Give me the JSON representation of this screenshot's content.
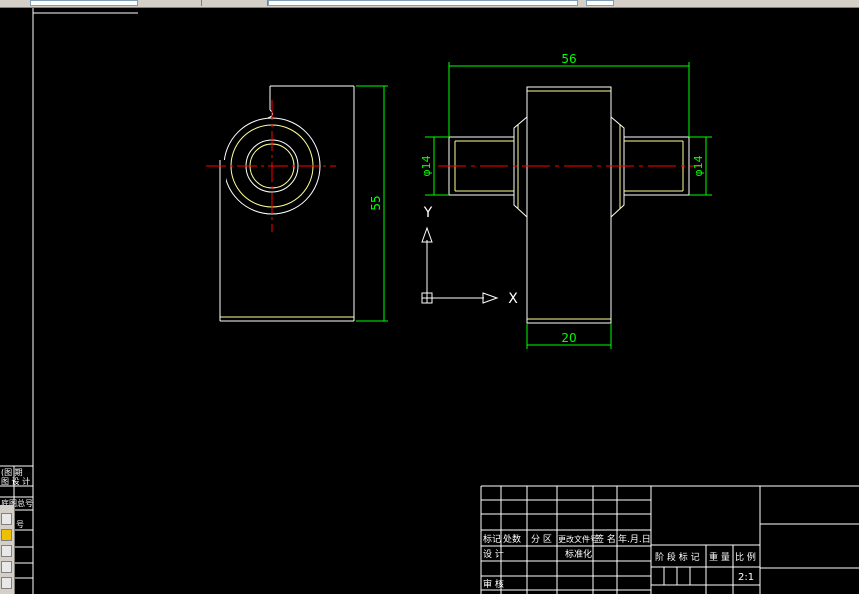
{
  "toolbar": {
    "layer_field": "",
    "linetype_field": ""
  },
  "drawing": {
    "dim_overall_width": "56",
    "dim_height": "55",
    "dim_diameter_left": "φ14",
    "dim_diameter_right": "φ14",
    "dim_bottom_width": "20",
    "ucs_x_label": "X",
    "ucs_y_label": "Y",
    "colors": {
      "background": "#000000",
      "geometry": "#ffffff",
      "dimension": "#00ff00",
      "centerline": "#ff0000",
      "hidden": "#ffff00"
    }
  },
  "title_block": {
    "rev_mark": "标记",
    "rev_count": "处数",
    "rev_zone": "分 区",
    "rev_doc": "更改文件号",
    "rev_sign": "签 名",
    "rev_date": "年.月.日",
    "design": "设 计",
    "standardize": "标准化",
    "review": "审 核",
    "stage_mark": "阶 段 标 记",
    "weight": "重 量",
    "scale": "比 例",
    "scale_value": "2:1"
  },
  "left_panel": {
    "row1": "(图 期",
    "row2": "图 设 计",
    "row3": "底图总号",
    "row4": "号"
  }
}
